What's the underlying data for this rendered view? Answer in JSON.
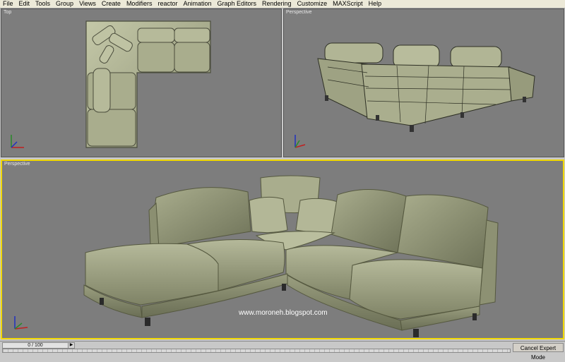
{
  "menubar": {
    "items": [
      "File",
      "Edit",
      "Tools",
      "Group",
      "Views",
      "Create",
      "Modifiers",
      "reactor",
      "Animation",
      "Graph Editors",
      "Rendering",
      "Customize",
      "MAXScript",
      "Help"
    ]
  },
  "viewports": {
    "top_label": "Top",
    "persp_small_label": "Perspective",
    "main_label": "Perspective"
  },
  "watermark": "www.moroneh.blogspot.com",
  "status": {
    "time_slider": "0 / 100",
    "cancel_expert_mode": "Cancel Expert Mode"
  },
  "colors": {
    "viewport_bg": "#7d7d7d",
    "sofa": "#a8ac8c",
    "active_border": "#f2d900"
  }
}
